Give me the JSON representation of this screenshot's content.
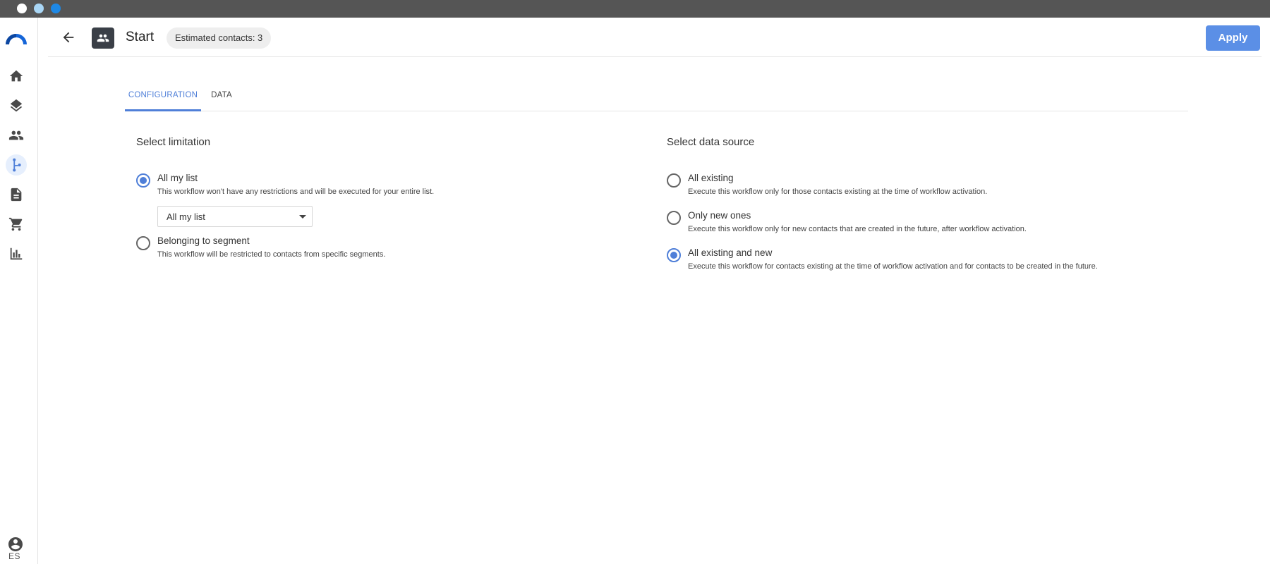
{
  "sidebar": {
    "items": [
      {
        "icon": "home-icon",
        "active": false
      },
      {
        "icon": "layers-icon",
        "active": false
      },
      {
        "icon": "contacts-icon",
        "active": false
      },
      {
        "icon": "workflow-icon",
        "active": true
      },
      {
        "icon": "document-icon",
        "active": false
      },
      {
        "icon": "cart-icon",
        "active": false
      },
      {
        "icon": "chart-icon",
        "active": false
      }
    ],
    "language": "ES"
  },
  "header": {
    "title": "Start",
    "badge": "Estimated contacts: 3",
    "apply_label": "Apply"
  },
  "tabs": [
    {
      "label": "CONFIGURATION",
      "active": true
    },
    {
      "label": "DATA",
      "active": false
    }
  ],
  "limitation": {
    "title": "Select limitation",
    "options": [
      {
        "label": "All my list",
        "description": "This workflow won't have any restrictions and will be executed for your entire list.",
        "checked": true
      },
      {
        "label": "Belonging to segment",
        "description": "This workflow will be restricted to contacts from specific segments.",
        "checked": false
      }
    ],
    "select_value": "All my list"
  },
  "data_source": {
    "title": "Select data source",
    "options": [
      {
        "label": "All existing",
        "description": "Execute this workflow only for those contacts existing at the time of workflow activation.",
        "checked": false
      },
      {
        "label": "Only new ones",
        "description": "Execute this workflow only for new contacts that are created in the future, after workflow activation.",
        "checked": false
      },
      {
        "label": "All existing and new",
        "description": "Execute this workflow for contacts existing at the time of workflow activation and for contacts to be created in the future.",
        "checked": true
      }
    ]
  },
  "colors": {
    "accent": "#4f7fd8",
    "apply_bg": "#5b8fe6",
    "titlebar": "#555555"
  }
}
